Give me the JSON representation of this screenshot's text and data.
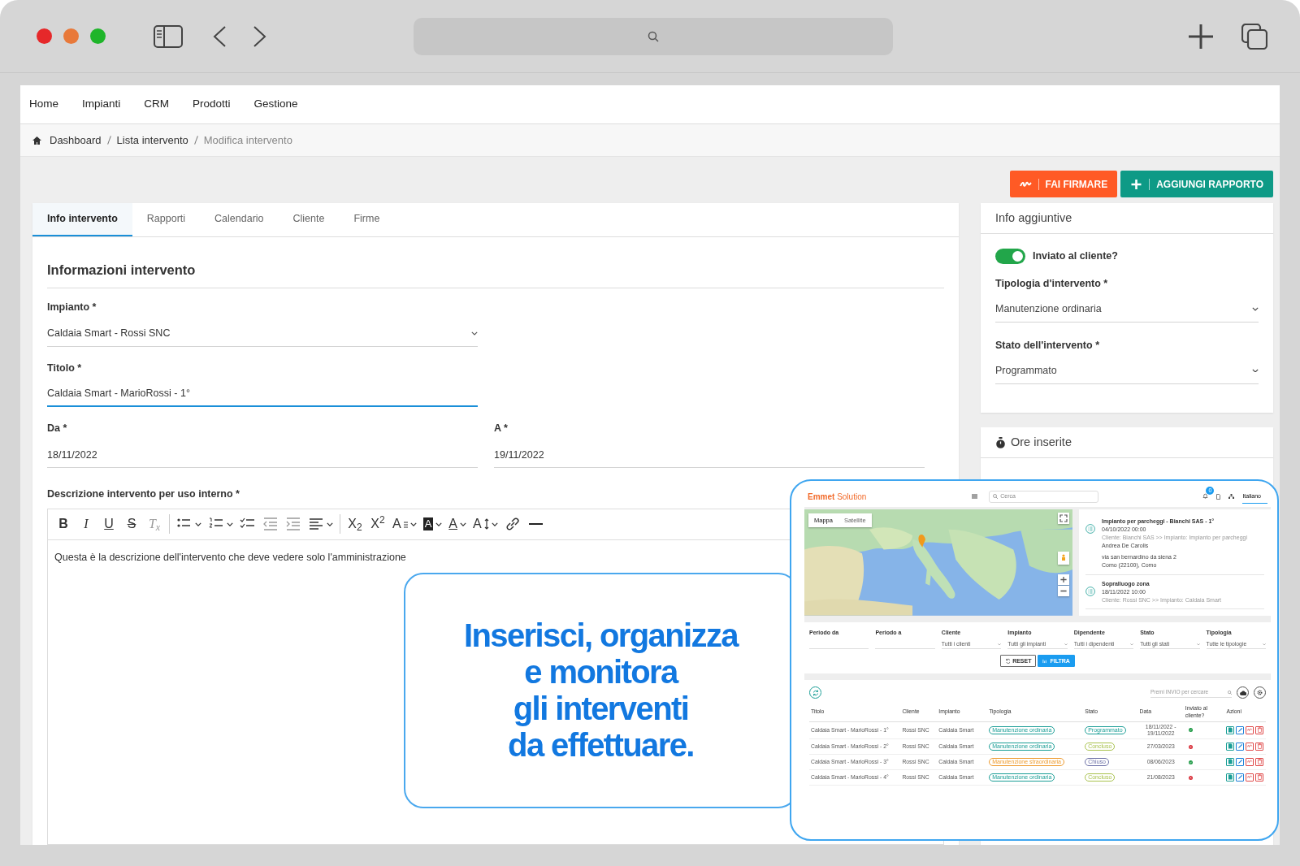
{
  "nav": [
    "Home",
    "Impianti",
    "CRM",
    "Prodotti",
    "Gestione"
  ],
  "breadcrumb": [
    {
      "label": "Dashboard",
      "current": false
    },
    {
      "label": "Lista intervento",
      "current": false
    },
    {
      "label": "Modifica intervento",
      "current": true
    }
  ],
  "actions": [
    {
      "kind": "sign",
      "label": "FAI FIRMARE"
    },
    {
      "kind": "add",
      "label": "AGGIUNGI RAPPORTO"
    }
  ],
  "tabs": [
    {
      "label": "Info intervento",
      "selected": true
    },
    {
      "label": "Rapporti",
      "selected": false
    },
    {
      "label": "Calendario",
      "selected": false
    },
    {
      "label": "Cliente",
      "selected": false
    },
    {
      "label": "Firme",
      "selected": false
    }
  ],
  "section_title": "Informazioni intervento",
  "field_rows": [
    [
      {
        "kind": "select",
        "label": "Impianto *",
        "value": "Caldaia Smart - Rossi SNC",
        "focused": false
      }
    ],
    [
      {
        "kind": "input",
        "label": "Titolo *",
        "value": "Caldaia Smart - MarioRossi - 1°",
        "focused": true
      }
    ],
    [
      {
        "kind": "input",
        "label": "Da *",
        "value": "18/11/2022",
        "focused": false
      },
      {
        "kind": "input",
        "label": "A *",
        "value": "19/11/2022",
        "focused": false
      }
    ]
  ],
  "editor": {
    "label": "Descrizione intervento per uso interno *",
    "text": "Questa è la descrizione dell'intervento che deve vedere solo l'amministrazione",
    "toolbar": [
      {
        "kind": "bold",
        "label": "B"
      },
      {
        "kind": "italic",
        "label": "I"
      },
      {
        "kind": "underline",
        "label": "U"
      },
      {
        "kind": "strike",
        "label": "S"
      },
      {
        "kind": "clear",
        "label": "T$_{x}$"
      },
      {
        "kind": "divider"
      },
      {
        "kind": "bullet-list",
        "dropdown": true
      },
      {
        "kind": "number-list",
        "dropdown": true
      },
      {
        "kind": "check-list"
      },
      {
        "kind": "outdent"
      },
      {
        "kind": "indent"
      },
      {
        "kind": "align",
        "dropdown": true
      },
      {
        "kind": "divider"
      },
      {
        "kind": "subscript",
        "label": "X$_{2}$"
      },
      {
        "kind": "superscript",
        "label": "X$^{2}$"
      },
      {
        "kind": "text-style",
        "label": "A",
        "dropdown": true
      },
      {
        "kind": "highlight",
        "label": "A",
        "dropdown": true
      },
      {
        "kind": "font-color",
        "label": "A",
        "dropdown": true
      },
      {
        "kind": "font-size",
        "label": "A",
        "dropdown": true
      },
      {
        "kind": "link"
      },
      {
        "kind": "rule"
      }
    ]
  },
  "side_info": {
    "title": "Info aggiuntive",
    "toggle": {
      "label": "Inviato al cliente?",
      "on": true
    },
    "selects": [
      {
        "label": "Tipologia d'intervento *",
        "value": "Manutenzione ordinaria"
      },
      {
        "label": "Stato dell'intervento *",
        "value": "Programmato"
      }
    ]
  },
  "hours_card": {
    "title": "Ore inserite"
  },
  "callout": {
    "lines": [
      "Inserisci, organizza",
      "e monitora",
      "gli interventi",
      "da effettuare."
    ]
  },
  "inset": {
    "logo": "**Emmet** Solution",
    "search_placeholder": "Cerca",
    "notifications": "0",
    "language": "Italiano",
    "map_types": [
      {
        "label": "Mappa",
        "selected": true
      },
      {
        "label": "Satellite",
        "selected": false
      }
    ],
    "events": [
      {
        "title": "Impianto per parcheggi - Bianchi SAS - 1°",
        "when": "04/10/2022 00:00",
        "detail": "Cliente: Bianchi SAS >> Impianto: Impianto per parcheggi",
        "person": "Andrea De Carolis",
        "address": [
          "via san bernardino da siena 2",
          "Como (22100), Como"
        ]
      },
      {
        "title": "Sopralluogo zona",
        "when": "18/11/2022 10:00",
        "detail": "Cliente: Rossi SNC >> Impianto: Caldaia Smart"
      }
    ],
    "filters": [
      {
        "kind": "date",
        "label": "Periodo da"
      },
      {
        "kind": "date",
        "label": "Periodo a"
      },
      {
        "kind": "select",
        "label": "Cliente",
        "value": "Tutti i clienti"
      },
      {
        "kind": "select",
        "label": "Impianto",
        "value": "Tutti gli impianti"
      },
      {
        "kind": "select",
        "label": "Dipendente",
        "value": "Tutti i dipendenti"
      },
      {
        "kind": "select",
        "label": "Stato",
        "value": "Tutti gli stati"
      },
      {
        "kind": "select",
        "label": "Tipologia",
        "value": "Tutte le tipologie"
      }
    ],
    "filter_buttons": [
      {
        "kind": "reset",
        "label": "RESET"
      },
      {
        "kind": "filter",
        "label": "FILTRA"
      }
    ],
    "table_search": "Premi INVIO per cercare",
    "columns": [
      "Titolo",
      "Cliente",
      "Impianto",
      "Tipologia",
      "Stato",
      "Data",
      "Inviato al cliente?",
      "Azioni"
    ],
    "rows": [
      {
        "title": "Caldaia Smart - MarioRossi - 1°",
        "client": "Rossi SNC",
        "plant": "Caldaia Smart",
        "type": {
          "label": "Manutenzione ordinaria",
          "color": "#1a9e96"
        },
        "status": {
          "label": "Programmato",
          "color": "#1a9e96"
        },
        "date": "18/11/2022 - 19/11/2022",
        "sent": true
      },
      {
        "title": "Caldaia Smart - MarioRossi - 2°",
        "client": "Rossi SNC",
        "plant": "Caldaia Smart",
        "type": {
          "label": "Manutenzione ordinaria",
          "color": "#1a9e96"
        },
        "status": {
          "label": "Concluso",
          "color": "#a9c24e"
        },
        "date": "27/03/2023",
        "sent": false
      },
      {
        "title": "Caldaia Smart - MarioRossi - 3°",
        "client": "Rossi SNC",
        "plant": "Caldaia Smart",
        "type": {
          "label": "Manutenzione straordinaria",
          "color": "#ee9a2c"
        },
        "status": {
          "label": "Chiuso",
          "color": "#6b6fa6"
        },
        "date": "08/06/2023",
        "sent": true
      },
      {
        "title": "Caldaia Smart - MarioRossi - 4°",
        "client": "Rossi SNC",
        "plant": "Caldaia Smart",
        "type": {
          "label": "Manutenzione ordinaria",
          "color": "#1a9e96"
        },
        "status": {
          "label": "Concluso",
          "color": "#a9c24e"
        },
        "date": "21/08/2023",
        "sent": false
      }
    ]
  }
}
